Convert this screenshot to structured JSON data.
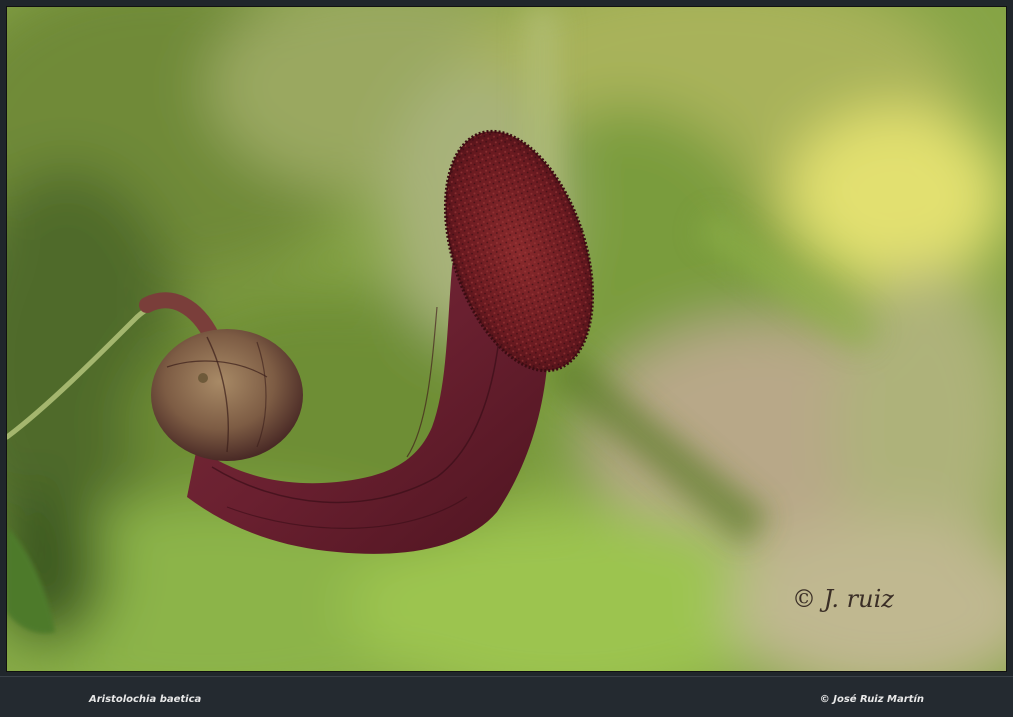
{
  "photo": {
    "signature": "© J. ruiz",
    "colors": {
      "background_green": "#8fb04a",
      "flower_purple": "#6a1e2a",
      "flower_lip": "#7a1f24",
      "bud_brown": "#8a6a4a",
      "stem_green": "#9ab064"
    }
  },
  "caption": {
    "species": "Aristolochia baetica",
    "credit": "© José Ruiz Martín"
  }
}
